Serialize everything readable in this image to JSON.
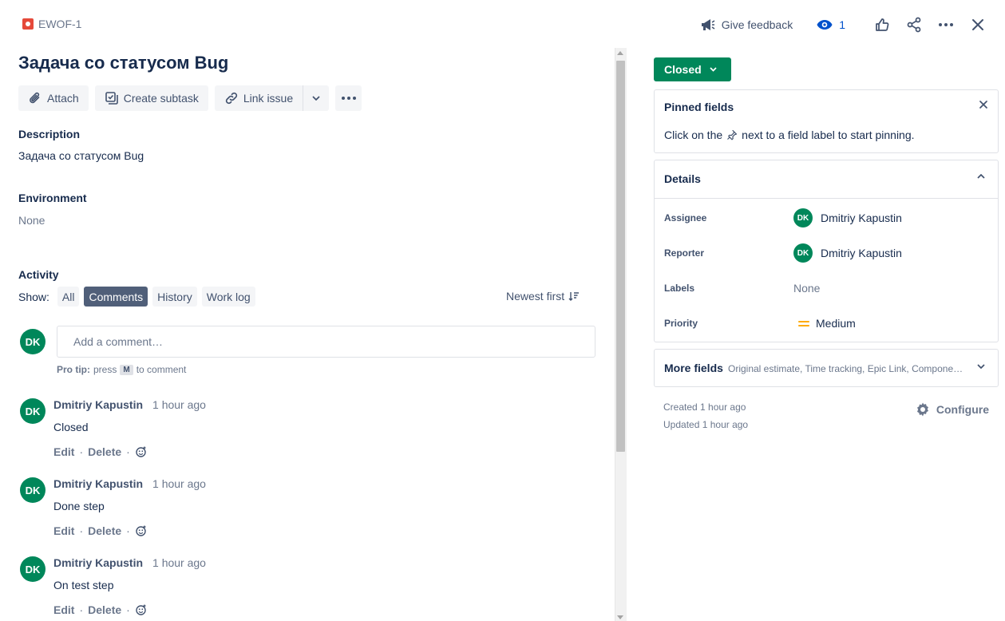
{
  "header": {
    "issue_key": "EWOF-1",
    "give_feedback": "Give feedback",
    "watch_count": "1"
  },
  "issue": {
    "title": "Задача со статусом Bug"
  },
  "toolbar": {
    "attach": "Attach",
    "create_subtask": "Create subtask",
    "link_issue": "Link issue"
  },
  "description": {
    "heading": "Description",
    "value": "Задача со статусом Bug"
  },
  "environment": {
    "heading": "Environment",
    "value": "None"
  },
  "activity": {
    "heading": "Activity",
    "show_label": "Show:",
    "filters": [
      "All",
      "Comments",
      "History",
      "Work log"
    ],
    "active_filter": "Comments",
    "sort": "Newest first",
    "current_user_initials": "DK",
    "comment_placeholder": "Add a comment…",
    "protip_bold": "Pro tip:",
    "protip_press": "press",
    "protip_key": "M",
    "protip_rest": "to comment",
    "comments": [
      {
        "initials": "DK",
        "author": "Dmitriy Kapustin",
        "time": "1 hour ago",
        "body": "Closed",
        "edit": "Edit",
        "delete": "Delete"
      },
      {
        "initials": "DK",
        "author": "Dmitriy Kapustin",
        "time": "1 hour ago",
        "body": "Done step",
        "edit": "Edit",
        "delete": "Delete"
      },
      {
        "initials": "DK",
        "author": "Dmitriy Kapustin",
        "time": "1 hour ago",
        "body": "On test step",
        "edit": "Edit",
        "delete": "Delete"
      }
    ]
  },
  "status": {
    "label": "Closed",
    "color": "#00875a"
  },
  "pinned": {
    "heading": "Pinned fields",
    "text_before": "Click on the",
    "text_after": "next to a field label to start pinning."
  },
  "details": {
    "heading": "Details",
    "assignee_label": "Assignee",
    "assignee_initials": "DK",
    "assignee_name": "Dmitriy Kapustin",
    "reporter_label": "Reporter",
    "reporter_initials": "DK",
    "reporter_name": "Dmitriy Kapustin",
    "labels_label": "Labels",
    "labels_value": "None",
    "priority_label": "Priority",
    "priority_value": "Medium"
  },
  "more_fields": {
    "heading": "More fields",
    "summary": "Original estimate, Time tracking, Epic Link, Components, Fix versions"
  },
  "meta": {
    "created_label": "Created",
    "created_value": "1 hour ago",
    "updated_label": "Updated",
    "updated_value": "1 hour ago",
    "configure": "Configure"
  }
}
